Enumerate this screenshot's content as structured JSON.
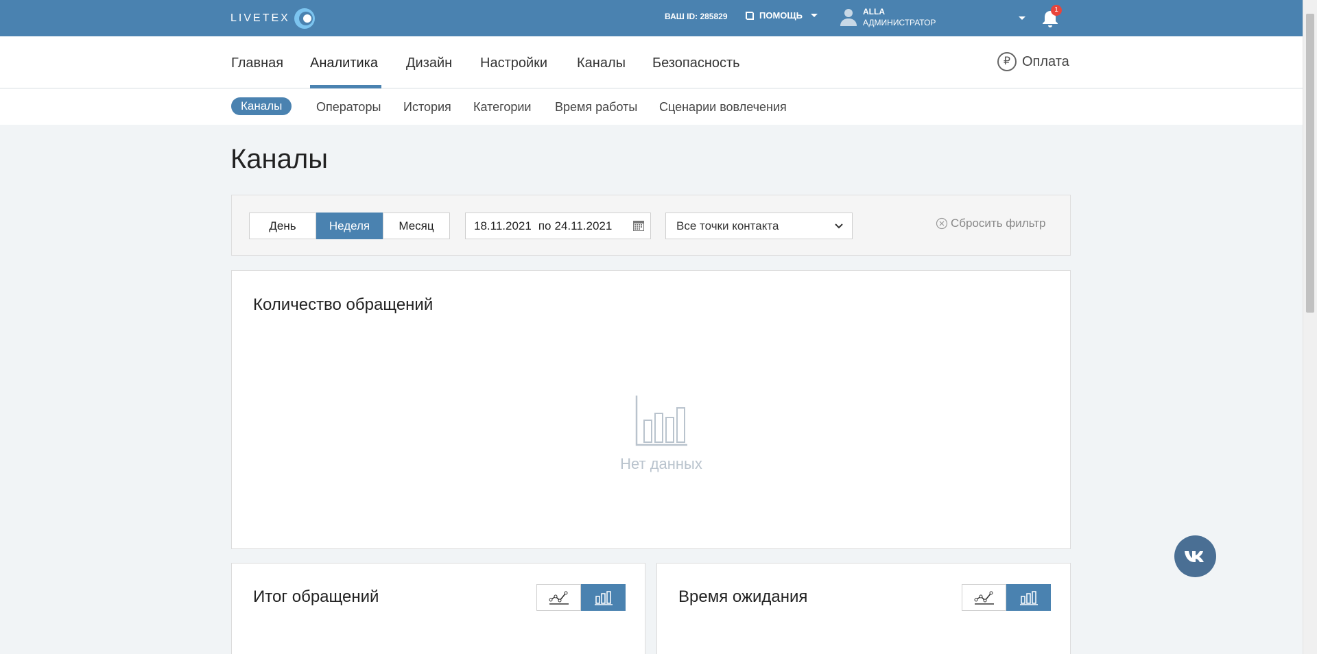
{
  "topbar": {
    "logo_text": "LIVETEX",
    "user_id_label": "ВАШ ID: 285829",
    "help_label": "ПОМОЩЬ",
    "user_name": "ALLA",
    "user_role": "АДМИНИСТРАТОР",
    "notifications_count": "1",
    "icons": [
      "logo-mark",
      "book-icon",
      "user-icon",
      "chevron-down-icon",
      "bell-icon"
    ]
  },
  "main_nav": {
    "items": [
      {
        "label": "Главная"
      },
      {
        "label": "Аналитика",
        "active": true
      },
      {
        "label": "Дизайн"
      },
      {
        "label": "Настройки"
      },
      {
        "label": "Каналы"
      },
      {
        "label": "Безопасность"
      }
    ],
    "payment_label": "Оплата",
    "payment_icon": "₽"
  },
  "sub_nav": {
    "items": [
      {
        "label": "Каналы",
        "active": true
      },
      {
        "label": "Операторы"
      },
      {
        "label": "История"
      },
      {
        "label": "Категории"
      },
      {
        "label": "Время работы"
      },
      {
        "label": "Сценарии вовлечения"
      }
    ]
  },
  "page": {
    "title": "Каналы"
  },
  "filter": {
    "periods": [
      "День",
      "Неделя",
      "Месяц"
    ],
    "active_period": "Неделя",
    "date_from": "18.11.2021",
    "date_to_prefix": "по",
    "date_to": "24.11.2021",
    "contact_points": "Все точки контакта",
    "reset_label": "Сбросить фильтр"
  },
  "cards": {
    "requests": {
      "title": "Количество обращений",
      "empty_text": "Нет данных"
    },
    "results": {
      "title": "Итог обращений",
      "active_view": "bar"
    },
    "wait_time": {
      "title": "Время ожидания",
      "active_view": "bar"
    }
  },
  "colors": {
    "brand": "#4a82b0",
    "background": "#f1f4f6",
    "badge": "#e8453c",
    "vk": "#4a6f94"
  }
}
